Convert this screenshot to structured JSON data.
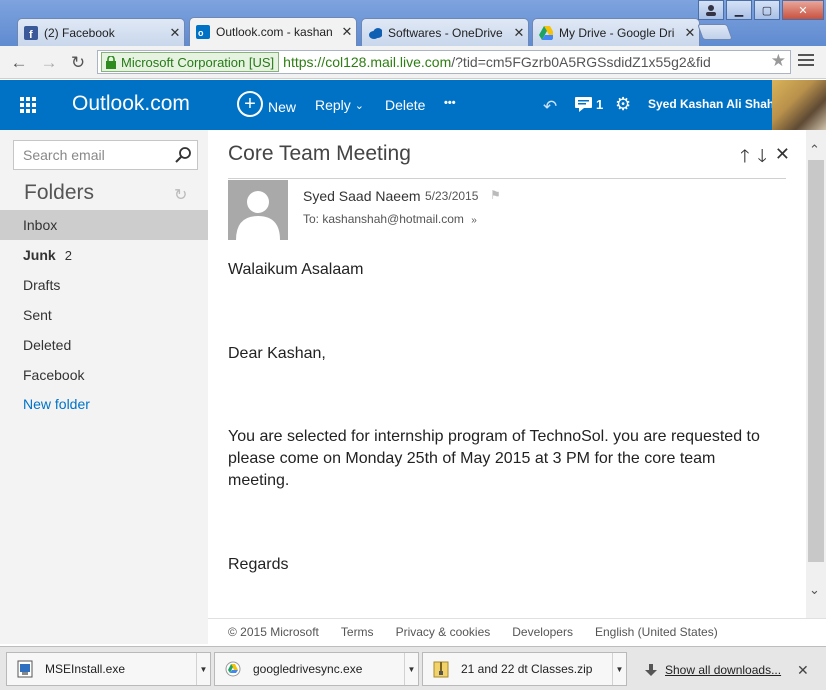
{
  "browser": {
    "tabs": [
      {
        "title": "(2) Facebook",
        "icon": "facebook-icon",
        "active": false
      },
      {
        "title": "Outlook.com - kashan",
        "icon": "outlook-icon",
        "active": true
      },
      {
        "title": "Softwares - OneDrive",
        "icon": "onedrive-icon",
        "active": false
      },
      {
        "title": "My Drive - Google Dri",
        "icon": "google-drive-icon",
        "active": false
      }
    ],
    "ev_certificate": "Microsoft Corporation [US]",
    "url_host": "https://col128.mail.live.com",
    "url_rest": "/?tid=cm5FGzrb0A5RGSsdidZ1x55g2&fid"
  },
  "outlook": {
    "brand": "Outlook.com",
    "commands": {
      "new": "New",
      "reply": "Reply",
      "delete": "Delete",
      "more": "•••"
    },
    "notification_count": "1",
    "user_name": "Syed Kashan Ali Shah",
    "brand_color": "#0072c6"
  },
  "sidebar": {
    "search_placeholder": "Search email",
    "folders_heading": "Folders",
    "folders": [
      {
        "label": "Inbox",
        "count": "",
        "selected": true
      },
      {
        "label": "Junk",
        "count": "2",
        "bold": true
      },
      {
        "label": "Drafts",
        "count": ""
      },
      {
        "label": "Sent",
        "count": ""
      },
      {
        "label": "Deleted",
        "count": ""
      },
      {
        "label": "Facebook",
        "count": ""
      }
    ],
    "new_folder": "New folder"
  },
  "message": {
    "subject": "Core Team Meeting",
    "sender": "Syed Saad Naeem",
    "date": "5/23/2015",
    "to": "To: kashanshah@hotmail.com",
    "greeting": "Walaikum Asalaam",
    "salutation": "Dear Kashan,",
    "body_line1": "You are selected for internship program of TechnoSol. you are requested to",
    "body_line2": "please come on Monday 25th of May 2015 at 3 PM  for the core team",
    "body_line3": "meeting.",
    "closing": "Regards"
  },
  "footer": {
    "copyright": "© 2015 Microsoft",
    "terms": "Terms",
    "privacy": "Privacy & cookies",
    "developers": "Developers",
    "language": "English (United States)"
  },
  "downloads": {
    "items": [
      {
        "name": "MSEInstall.exe",
        "icon": "installer-icon"
      },
      {
        "name": "googledrivesync.exe",
        "icon": "google-drive-sync-icon"
      },
      {
        "name": "21 and 22 dt Classes.zip",
        "icon": "zip-archive-icon"
      }
    ],
    "show_all": "Show all downloads..."
  }
}
